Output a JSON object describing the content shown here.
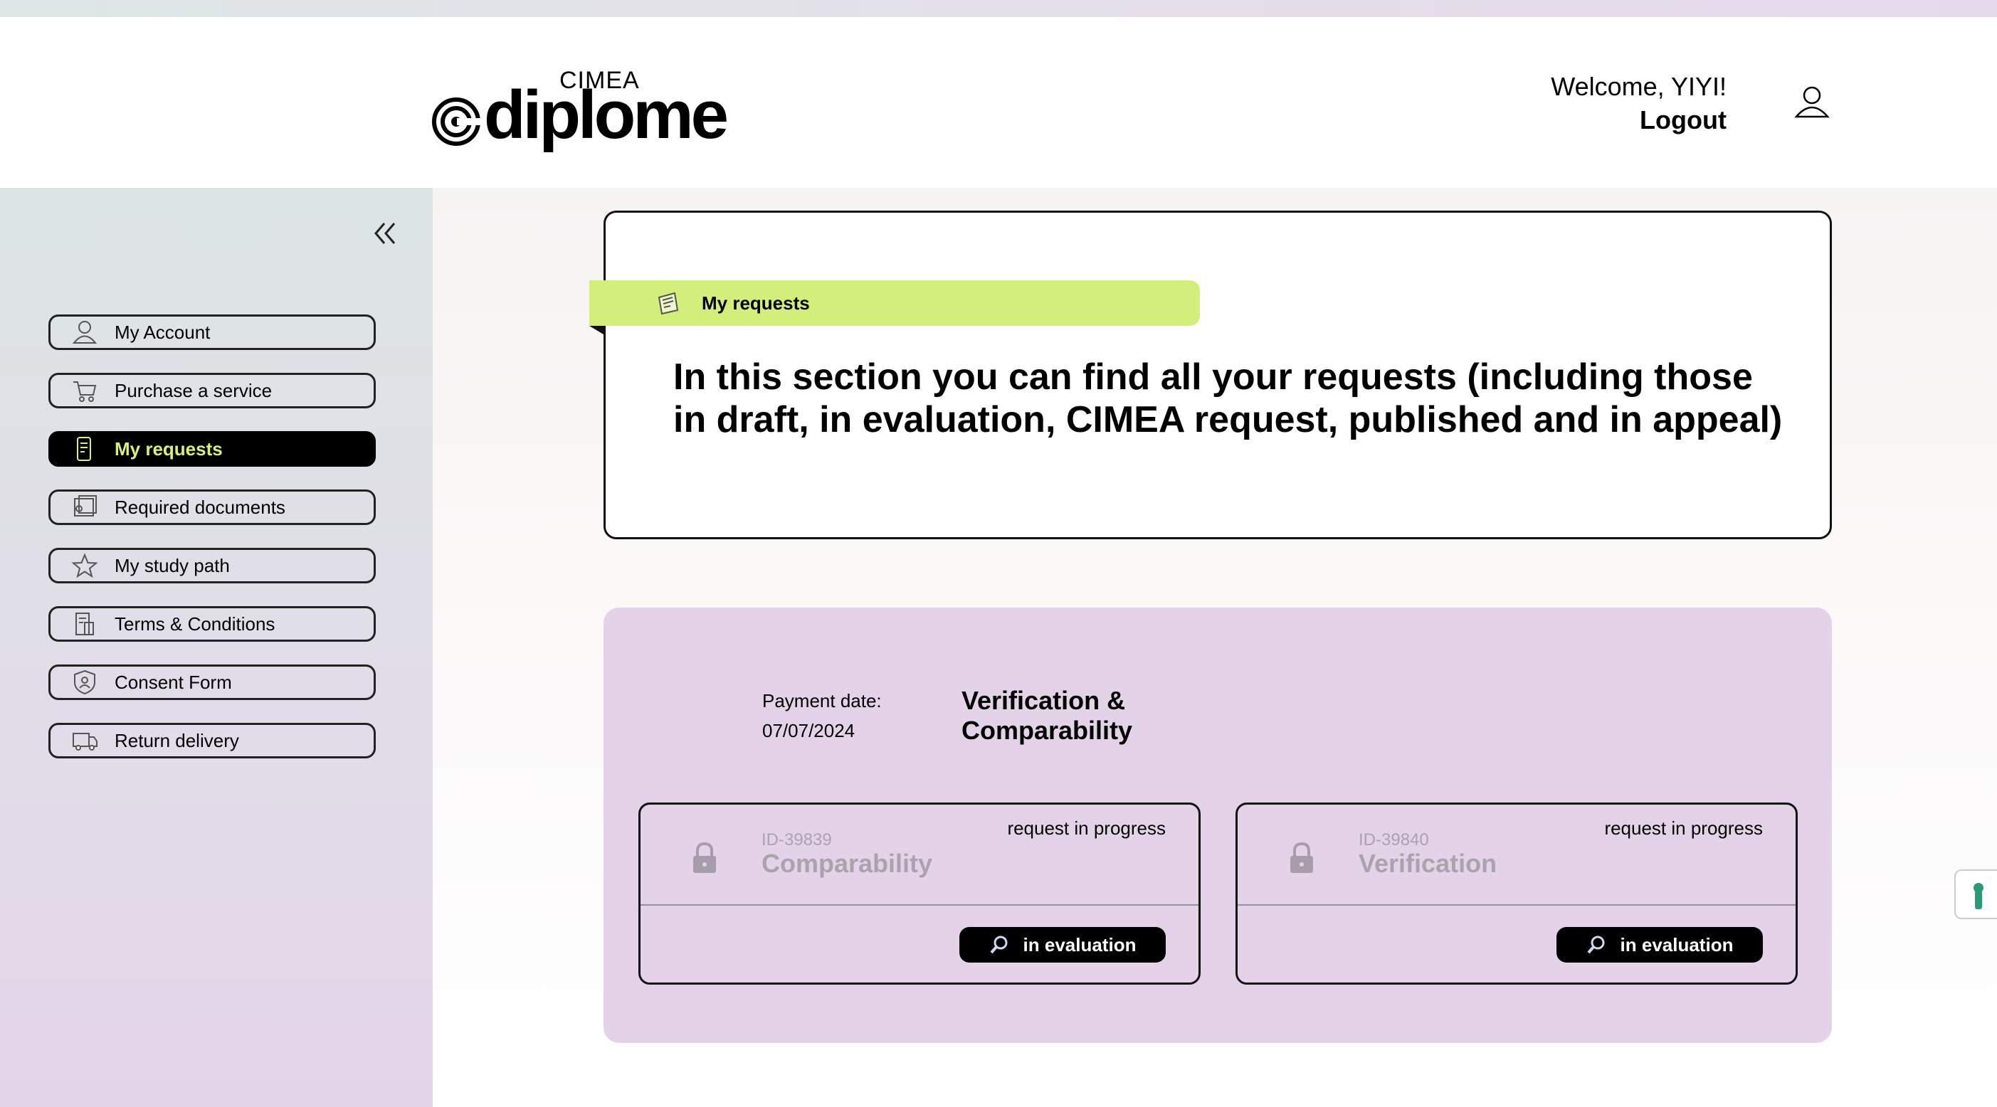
{
  "header": {
    "logo_brand": "CIMEA",
    "logo_word": "diplome",
    "welcome": "Welcome, YIYI!",
    "logout": "Logout"
  },
  "sidebar": {
    "items": [
      {
        "label": "My Account",
        "icon": "user-icon"
      },
      {
        "label": "Purchase a service",
        "icon": "cart-icon"
      },
      {
        "label": "My requests",
        "icon": "phone-document-icon",
        "active": true
      },
      {
        "label": "Required documents",
        "icon": "documents-icon"
      },
      {
        "label": "My study path",
        "icon": "star-icon"
      },
      {
        "label": "Terms & Conditions",
        "icon": "terms-icon"
      },
      {
        "label": "Consent Form",
        "icon": "shield-user-icon"
      },
      {
        "label": "Return delivery",
        "icon": "truck-icon"
      }
    ]
  },
  "main": {
    "section_tag": "My requests",
    "intro": "In this section you can find all your requests (including those in draft, in evaluation, CIMEA request, published and in appeal)",
    "purchase": {
      "payment_label": "Payment date:",
      "payment_date": "07/07/2024",
      "service": "Verification & Comparability",
      "requests": [
        {
          "id": "ID-39839",
          "name": "Comparability",
          "status": "request in progress",
          "badge": "in evaluation"
        },
        {
          "id": "ID-39840",
          "name": "Verification",
          "status": "request in progress",
          "badge": "in evaluation"
        }
      ]
    }
  },
  "colors": {
    "accent_green": "#d3ee7a",
    "card_lilac": "#e4d3e8",
    "active_text": "#d6f07a",
    "muted_text": "#aaa3ad"
  }
}
